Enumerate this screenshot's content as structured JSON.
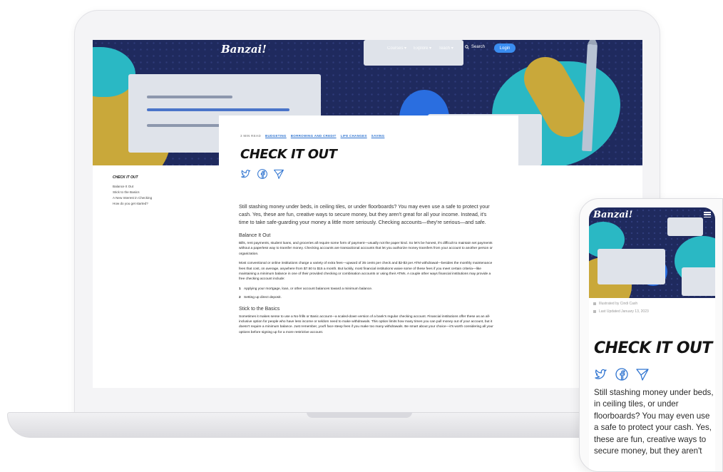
{
  "site": {
    "brand": "Banzai!"
  },
  "nav": {
    "items": [
      "Courses ▾",
      "Explore ▾",
      "Teach ▾"
    ],
    "search_label": "Search",
    "login_label": "Login"
  },
  "article": {
    "read_time": "3 MIN READ",
    "tags": [
      "BUDGETING",
      "BORROWING AND CREDIT",
      "LIFE CHANGES",
      "SAVING"
    ],
    "title": "CHECK IT OUT",
    "lede": "Still stashing money under beds, in ceiling tiles, or under floorboards? You may even use a safe to protect your cash. Yes, these are fun, creative ways to secure money, but they aren't great for all your income. Instead, it's time to take safe-guarding your money a little more seriously. Checking accounts—they're serious—and safe.",
    "sections": [
      {
        "heading": "Balance It Out",
        "p1": "Bills, rent payments, student loans, and groceries all require some form of payment—usually not the paper kind. So let's be honest, it's difficult to maintain set payments without a paperless way to transfer money. Checking accounts are transactional accounts that let you authorize money transfers from your account to another person or organization.",
        "p2": "Most conventional or online institutions charge a variety of extra fees—upward of 35 cents per check and $2-$3 per ATM withdrawal—besides the monthly maintenance fees that cost, on average, anywhere from $7.50 to $15 a month. But luckily, most financial institutions waive some of these fees if you meet certain criteria—like maintaining a minimum balance in one of their provided checking or combination accounts or using their ATMs. A couple other ways financial institutions may provide a free checking account include:",
        "bullets": [
          "Applying your mortgage, loan, or other account balances toward a minimum balance.",
          "Setting up direct deposit."
        ]
      },
      {
        "heading": "Stick to the Basics",
        "p1": "Sometimes it makes sense to use a No-frills or Basic account—a scaled-down version of a bank's regular checking account. Financial institutions offer these as an all-inclusive option for people who have less income or seldom need to make withdrawals. This option limits how many times you can pull money out of your account, but it doesn't require a minimum balance. Just remember, you'll face steep fees if you make too many withdrawals. Be smart about your choice—it's worth considering all your options before signing up for a more restrictive account."
      }
    ]
  },
  "toc": {
    "title": "CHECK IT OUT",
    "items": [
      "Balance It Out",
      "Stick to the Basics",
      "A New Interest in Checking",
      "How do you get started?"
    ]
  },
  "mobile": {
    "brand": "Banzai!",
    "illustrated_by": "Illustrated by Cindi Cash",
    "last_updated": "Last Updated January 13, 2023",
    "title": "CHECK IT OUT",
    "body": "Still stashing money under beds, in ceiling tiles, or under floorboards? You may even use a safe to protect your cash. Yes, these are fun, creative ways to secure money, but they aren't"
  },
  "colors": {
    "hero_navy": "#1f2a5e",
    "accent_blue": "#2f74d0",
    "login_blue": "#3a8df0",
    "mustard": "#c9a83a",
    "teal": "#2ab8c4"
  },
  "icons": [
    "twitter-icon",
    "facebook-icon",
    "send-icon",
    "search-icon",
    "menu-icon"
  ]
}
